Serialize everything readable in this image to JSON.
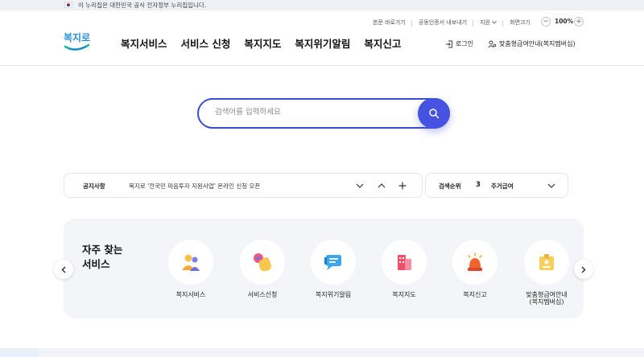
{
  "gov_banner": {
    "text": "이 누리집은 대한민국 공식 전자정부 누리집입니다."
  },
  "utility": {
    "links": [
      "본문 바로가기",
      "공동인증서 내보내기",
      "지원",
      "화면크기"
    ],
    "zoom_minus": "−",
    "zoom_value": "100%",
    "zoom_plus": "+"
  },
  "header": {
    "logo_text": "복지로",
    "gnb": [
      "복지서비스",
      "서비스 신청",
      "복지지도",
      "복지위기알림",
      "복지신고"
    ],
    "login": "로그인",
    "benefit_guide": "맞춤형급여안내(복지멤버십)"
  },
  "search": {
    "placeholder": "검색어를 입력하세요"
  },
  "notice": {
    "label": "공지사항",
    "text": "복지로 '전국민 마음투자 지원사업' 온라인 신청 오픈"
  },
  "rank": {
    "label": "검색순위",
    "number": "3",
    "keyword": "주거급여"
  },
  "quick": {
    "title_line1": "자주 찾는",
    "title_line2": "서비스",
    "items": [
      {
        "label": "복지서비스",
        "icon": "people-icon"
      },
      {
        "label": "서비스신청",
        "icon": "hand-click-icon"
      },
      {
        "label": "복지위기알림",
        "icon": "message-icon"
      },
      {
        "label": "복지지도",
        "icon": "building-icon"
      },
      {
        "label": "복지신고",
        "icon": "siren-icon"
      },
      {
        "label_line1": "맞춤형급여안내",
        "label_line2": "(복지멤버십)",
        "icon": "id-card-icon"
      }
    ]
  },
  "colors": {
    "accent": "#4652e0",
    "border_accent": "#3b4bd6",
    "panel": "#f4f5f8"
  }
}
